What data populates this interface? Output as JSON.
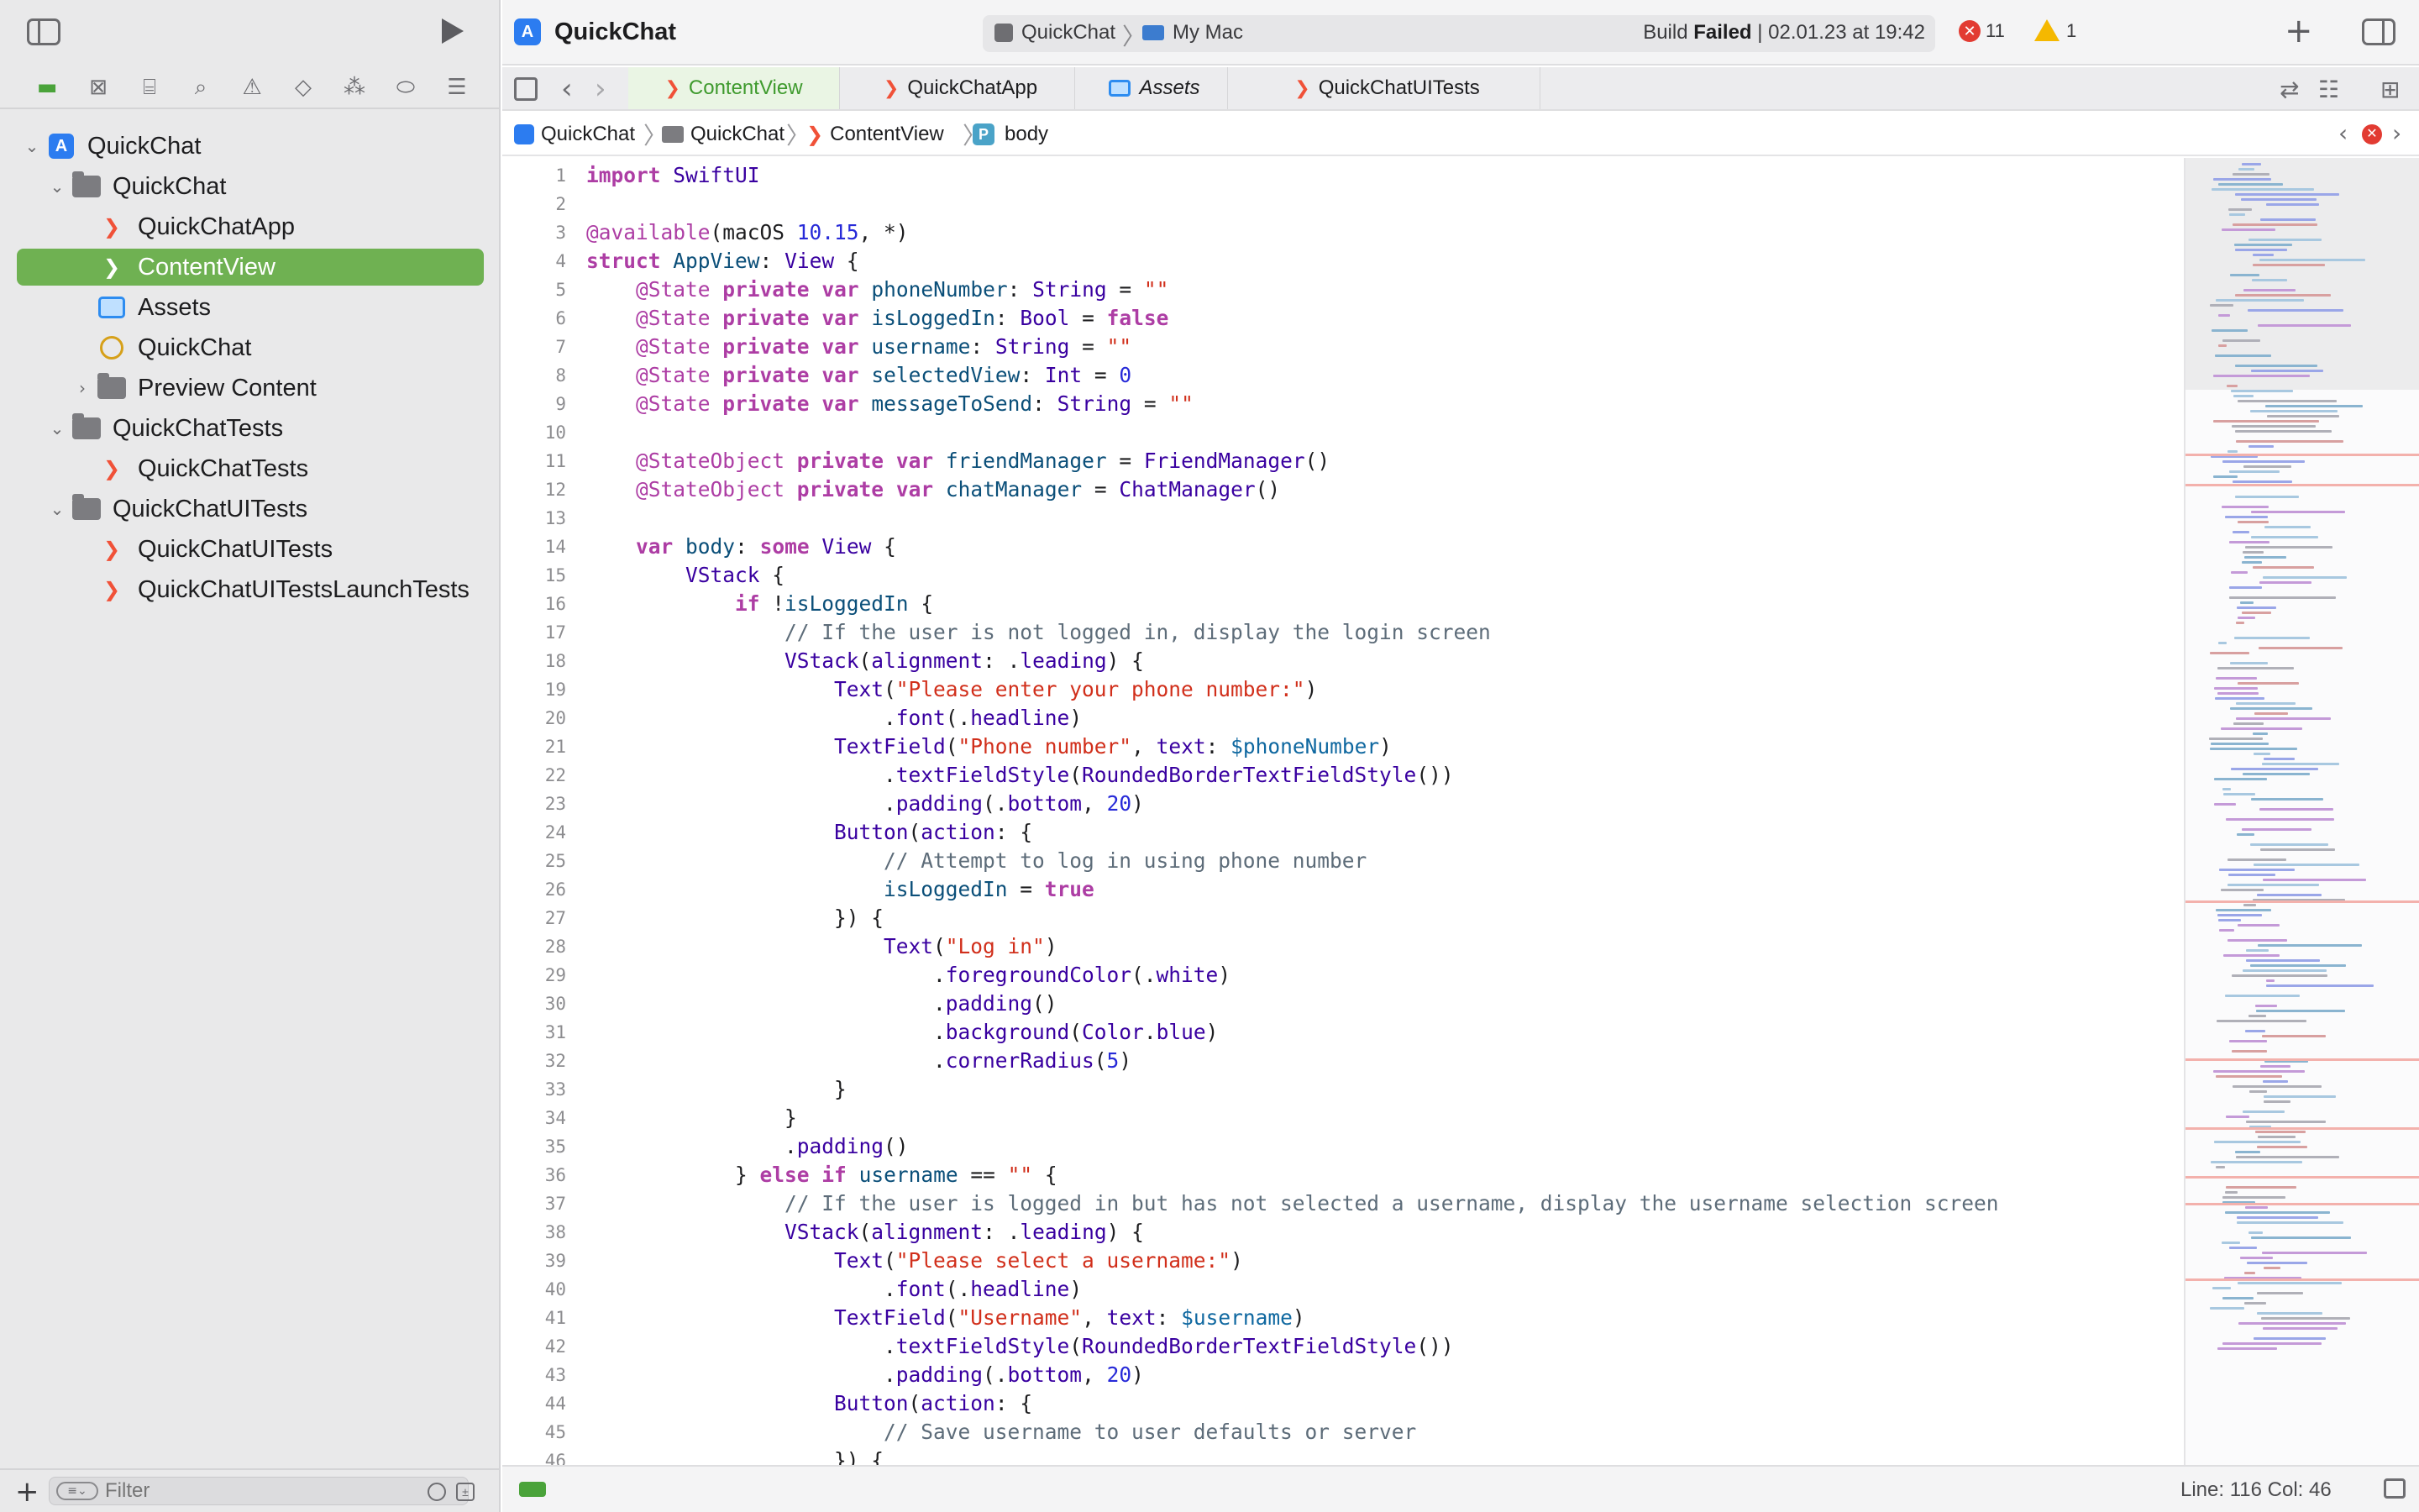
{
  "window": {
    "title": "QuickChat",
    "scheme": "QuickChat",
    "destination": "My Mac",
    "build_label": "Build",
    "build_result": "Failed",
    "build_time": "| 02.01.23 at 19:42",
    "error_count": "11",
    "warning_count": "1"
  },
  "navigator": {
    "tabs": [
      "project-navigator",
      "source-control-navigator",
      "symbol-navigator",
      "find-navigator",
      "issue-navigator",
      "test-navigator",
      "debug-navigator",
      "breakpoint-navigator",
      "report-navigator"
    ],
    "tree": [
      {
        "label": "QuickChat",
        "icon": "project-icon",
        "depth": 0,
        "disclosure": "open"
      },
      {
        "label": "QuickChat",
        "icon": "folder-icon",
        "depth": 1,
        "disclosure": "open"
      },
      {
        "label": "QuickChatApp",
        "icon": "swift-file-icon",
        "depth": 2,
        "disclosure": ""
      },
      {
        "label": "ContentView",
        "icon": "swift-file-icon",
        "depth": 2,
        "disclosure": "",
        "selected": true
      },
      {
        "label": "Assets",
        "icon": "assets-icon",
        "depth": 2,
        "disclosure": ""
      },
      {
        "label": "QuickChat",
        "icon": "entitlements-icon",
        "depth": 2,
        "disclosure": ""
      },
      {
        "label": "Preview Content",
        "icon": "folder-icon",
        "depth": 2,
        "disclosure": "closed"
      },
      {
        "label": "QuickChatTests",
        "icon": "folder-icon",
        "depth": 1,
        "disclosure": "open"
      },
      {
        "label": "QuickChatTests",
        "icon": "swift-file-icon",
        "depth": 2,
        "disclosure": ""
      },
      {
        "label": "QuickChatUITests",
        "icon": "folder-icon",
        "depth": 1,
        "disclosure": "open"
      },
      {
        "label": "QuickChatUITests",
        "icon": "swift-file-icon",
        "depth": 2,
        "disclosure": ""
      },
      {
        "label": "QuickChatUITestsLaunchTests",
        "icon": "swift-file-icon",
        "depth": 2,
        "disclosure": ""
      }
    ],
    "filter_placeholder": "Filter"
  },
  "tabs": [
    {
      "label": "ContentView",
      "icon": "swift-file-icon",
      "active": true
    },
    {
      "label": "QuickChatApp",
      "icon": "swift-file-icon",
      "active": false
    },
    {
      "label": "Assets",
      "icon": "assets-icon",
      "active": false,
      "italic": true
    },
    {
      "label": "QuickChatUITests",
      "icon": "swift-file-icon",
      "active": false
    }
  ],
  "jumpbar": [
    "QuickChat",
    "QuickChat",
    "ContentView",
    "body"
  ],
  "code_lines": [
    "import SwiftUI",
    "",
    "@available(macOS 10.15, *)",
    "struct AppView: View {",
    "    @State private var phoneNumber: String = \"\"",
    "    @State private var isLoggedIn: Bool = false",
    "    @State private var username: String = \"\"",
    "    @State private var selectedView: Int = 0",
    "    @State private var messageToSend: String = \"\"",
    "",
    "    @StateObject private var friendManager = FriendManager()",
    "    @StateObject private var chatManager = ChatManager()",
    "",
    "    var body: some View {",
    "        VStack {",
    "            if !isLoggedIn {",
    "                // If the user is not logged in, display the login screen",
    "                VStack(alignment: .leading) {",
    "                    Text(\"Please enter your phone number:\")",
    "                        .font(.headline)",
    "                    TextField(\"Phone number\", text: $phoneNumber)",
    "                        .textFieldStyle(RoundedBorderTextFieldStyle())",
    "                        .padding(.bottom, 20)",
    "                    Button(action: {",
    "                        // Attempt to log in using phone number",
    "                        isLoggedIn = true",
    "                    }) {",
    "                        Text(\"Log in\")",
    "                            .foregroundColor(.white)",
    "                            .padding()",
    "                            .background(Color.blue)",
    "                            .cornerRadius(5)",
    "                    }",
    "                }",
    "                .padding()",
    "            } else if username == \"\" {",
    "                // If the user is logged in but has not selected a username, display the username selection screen",
    "                VStack(alignment: .leading) {",
    "                    Text(\"Please select a username:\")",
    "                        .font(.headline)",
    "                    TextField(\"Username\", text: $username)",
    "                        .textFieldStyle(RoundedBorderTextFieldStyle())",
    "                        .padding(.bottom, 20)",
    "                    Button(action: {",
    "                        // Save username to user defaults or server",
    "                    }) {"
  ],
  "status": {
    "position": "Line: 116  Col: 46"
  },
  "colors": {
    "accent": "#6fb152",
    "error": "#e23b32",
    "warning": "#f5b800"
  }
}
